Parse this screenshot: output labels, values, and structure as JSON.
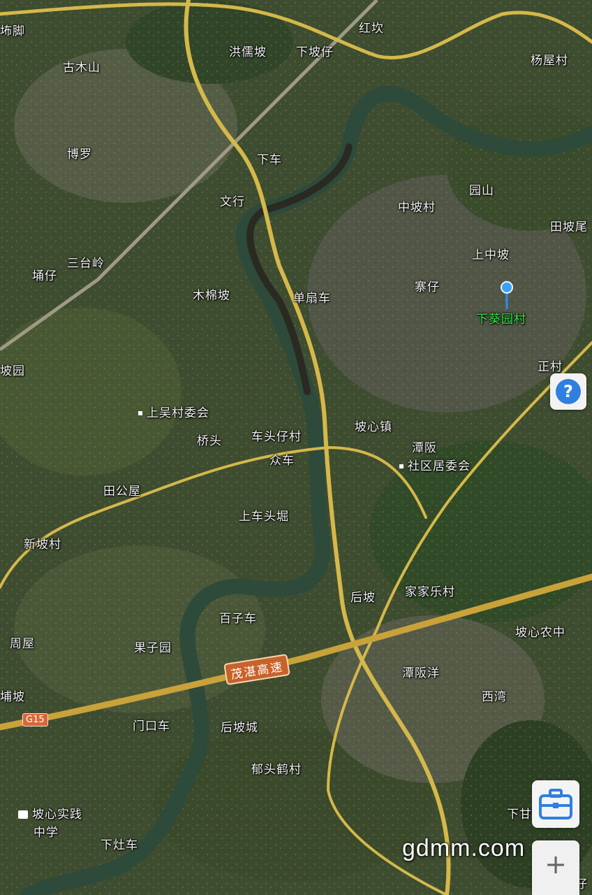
{
  "labels": {
    "jiao": "㘵脚",
    "guxmushan": "古木山",
    "hongrupo": "洪儒坡",
    "xiapozai": "下坡仔",
    "hongkan": "红坎",
    "yangwucun": "杨屋村",
    "boluo": "博罗",
    "xiache": "下车",
    "wenxing": "文行",
    "zhongpocun": "中坡村",
    "yuanshan": "园山",
    "tianpowei": "田坡尾",
    "yongzai": "埇仔",
    "santailing": "三台岭",
    "shangzhongpo": "上中坡",
    "mumianpo": "木棉坡",
    "danshanche": "单扇车",
    "zhaizai": "寨仔",
    "xiakuiyuancun": "下葵园村",
    "poyuan": "坡园",
    "zhengcun": "正村",
    "shangwucunweihui": "上吴村委会",
    "poxinzhen": "坡心镇",
    "qiaotou": "桥头",
    "chetouzaicun": "车头仔村",
    "tanfan": "潭阪",
    "shequjuweihui": "社区居委会",
    "zhongche": "众车",
    "tiangongwu": "田公屋",
    "shangchetoujue": "上车头堀",
    "xinpocun": "新坡村",
    "houpo": "后坡",
    "jiajialecun": "家家乐村",
    "baiziche": "百子车",
    "zhouwu": "周屋",
    "guoziyuan": "果子园",
    "poxinnongzhong": "坡心农中",
    "tanfanyang": "潭阪洋",
    "xiwan": "西湾",
    "puopo": "埔坡",
    "menkouche": "门口车",
    "houpocheng": "后坡城",
    "yutouhecun": "郁头鹤村",
    "poxinshijian": "坡心实践",
    "zhongxue": "中学",
    "xiazaoche": "下灶车",
    "xiagan": "下甘",
    "shangcunzai": "上村仔"
  },
  "roads": {
    "expressway": "茂湛高速",
    "g15": "G15"
  },
  "watermark": "gdmm.com",
  "controls": {
    "help": "?",
    "zoom_in": "+"
  },
  "colors": {
    "road": "#d4b84a",
    "river": "#2d4a3a",
    "marker": "#39e34a",
    "shield": "#c8622a"
  }
}
